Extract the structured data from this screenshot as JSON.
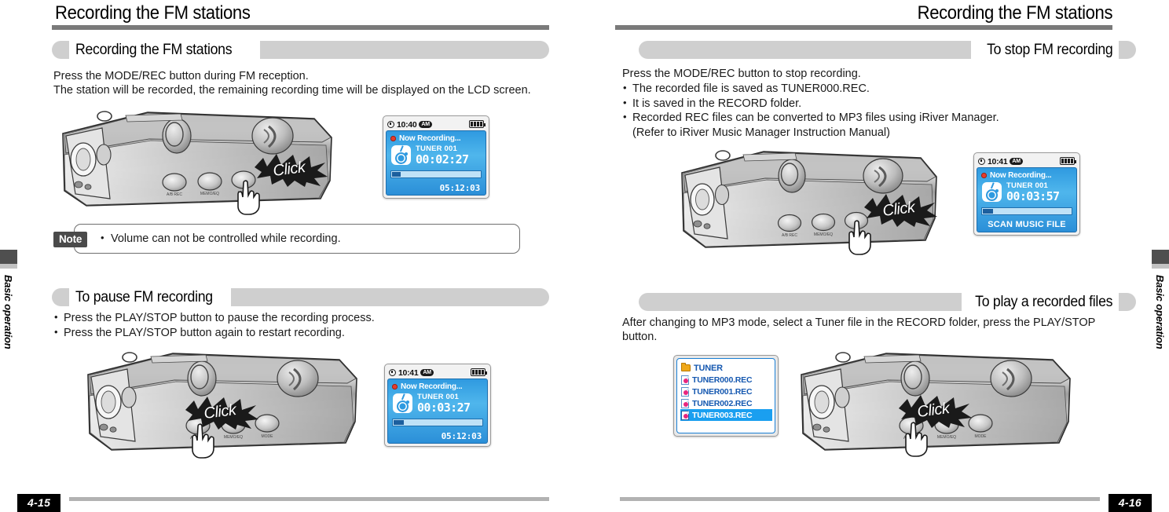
{
  "left_page": {
    "running_head": "Recording the FM stations",
    "page_number": "4-15",
    "side_tab": "Basic operation",
    "sections": [
      {
        "title": "Recording the FM stations",
        "body": "Press the MODE/REC button during FM reception.\nThe station will be recorded, the remaining recording time will be displayed on the LCD screen."
      },
      {
        "title": "To pause FM recording",
        "bullets": [
          "Press the PLAY/STOP button to pause the recording process.",
          "Press the PLAY/STOP button again to restart recording."
        ]
      }
    ],
    "note": {
      "tag": "Note",
      "text": "Volume can not be controlled while recording."
    },
    "lcd_recording": {
      "time": "10:40",
      "ampm": "AM",
      "status": "Now Recording...",
      "track": "TUNER 001",
      "elapsed": "00:02:27",
      "remaining": "05:12:03",
      "progress_percent": 8
    },
    "lcd_paused": {
      "time": "10:41",
      "ampm": "AM",
      "status": "Now Recording...",
      "track": "TUNER 001",
      "elapsed": "00:03:27",
      "remaining": "05:12:03",
      "progress_percent": 11
    },
    "click_label": "Click"
  },
  "right_page": {
    "running_head": "Recording the FM stations",
    "page_number": "4-16",
    "side_tab": "Basic operation",
    "sections": [
      {
        "title": "To stop FM recording",
        "body": "Press the MODE/REC button to stop recording.",
        "bullets": [
          "The recorded file is saved as TUNER000.REC.",
          "It is saved in the RECORD folder.",
          "Recorded REC files can be converted to MP3 files using iRiver Manager.\n(Refer to iRiver Music Manager Instruction Manual)"
        ]
      },
      {
        "title": "To play a recorded files",
        "body": "After changing to MP3 mode, select a Tuner file in the RECORD folder, press the PLAY/STOP\nbutton."
      }
    ],
    "lcd_stop": {
      "time": "10:41",
      "ampm": "AM",
      "status": "Now Recording...",
      "track": "TUNER 001",
      "elapsed": "00:03:57",
      "footer": "SCAN MUSIC FILE",
      "progress_percent": 11
    },
    "file_browser": {
      "folder": "TUNER",
      "files": [
        {
          "name": "TUNER000.REC",
          "selected": false
        },
        {
          "name": "TUNER001.REC",
          "selected": false
        },
        {
          "name": "TUNER002.REC",
          "selected": false
        },
        {
          "name": "TUNER003.REC",
          "selected": true
        }
      ]
    },
    "click_label": "Click"
  },
  "colors": {
    "rule_gray": "#7a7a7a",
    "pill_gray": "#cfcfcf",
    "lcd_blue": "#3aa6e4",
    "lcd_border": "#1f6fae",
    "select_blue": "#1a9ff0",
    "rec_red": "#e43b2c",
    "folder_orange": "#f0a818",
    "footer_rule": "#b2b2b2"
  }
}
